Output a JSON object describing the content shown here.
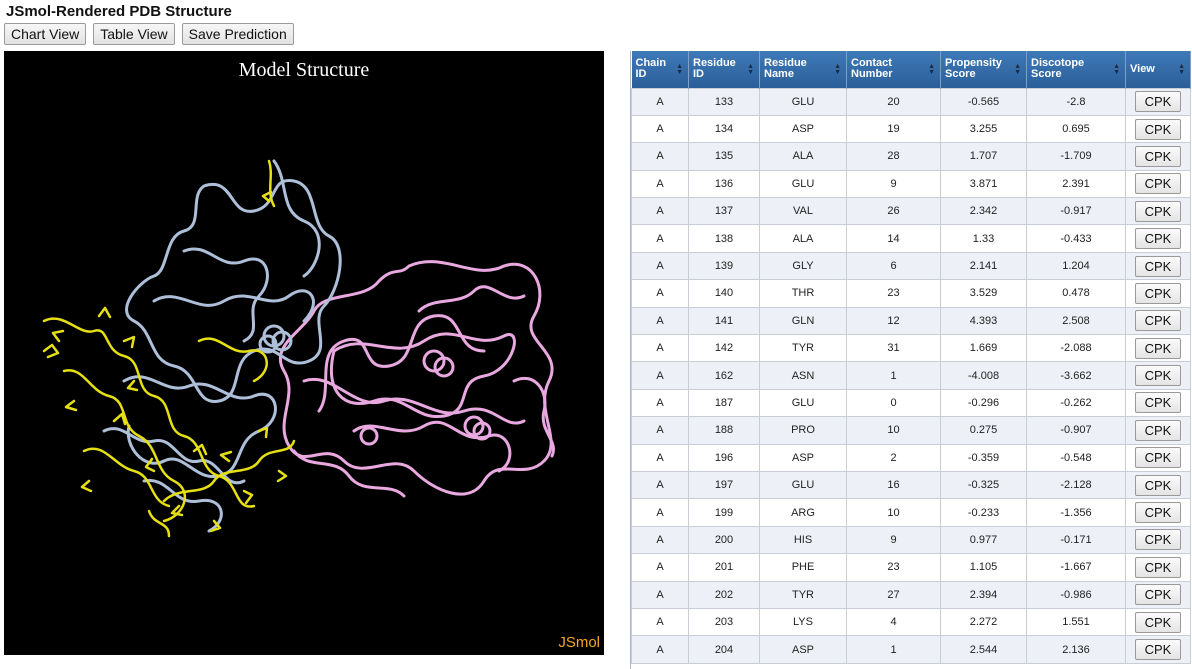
{
  "page": {
    "title": "JSmol-Rendered PDB Structure"
  },
  "toolbar": {
    "chart_view": "Chart View",
    "table_view": "Table View",
    "save_prediction": "Save Prediction"
  },
  "viewer": {
    "title": "Model Structure",
    "brand": "JSmol",
    "colors": {
      "background": "#000000",
      "chain_a": "#aebfd9",
      "chain_b": "#e9a9e0",
      "epitope": "#e6e013",
      "brand": "#f5a623"
    }
  },
  "table": {
    "headers": [
      {
        "line1": "Chain",
        "line2": "ID"
      },
      {
        "line1": "Residue",
        "line2": "ID"
      },
      {
        "line1": "Residue",
        "line2": "Name"
      },
      {
        "line1": "Contact",
        "line2": "Number"
      },
      {
        "line1": "Propensity",
        "line2": "Score"
      },
      {
        "line1": "Discotope",
        "line2": "Score"
      },
      {
        "line1": "View",
        "line2": ""
      }
    ],
    "header_color": "#3a74b3",
    "rows": [
      {
        "chain": "A",
        "residue_id": "133",
        "residue_name": "GLU",
        "contact": "20",
        "propensity": "-0.565",
        "discotope": "-2.8",
        "view": "CPK"
      },
      {
        "chain": "A",
        "residue_id": "134",
        "residue_name": "ASP",
        "contact": "19",
        "propensity": "3.255",
        "discotope": "0.695",
        "view": "CPK"
      },
      {
        "chain": "A",
        "residue_id": "135",
        "residue_name": "ALA",
        "contact": "28",
        "propensity": "1.707",
        "discotope": "-1.709",
        "view": "CPK"
      },
      {
        "chain": "A",
        "residue_id": "136",
        "residue_name": "GLU",
        "contact": "9",
        "propensity": "3.871",
        "discotope": "2.391",
        "view": "CPK"
      },
      {
        "chain": "A",
        "residue_id": "137",
        "residue_name": "VAL",
        "contact": "26",
        "propensity": "2.342",
        "discotope": "-0.917",
        "view": "CPK"
      },
      {
        "chain": "A",
        "residue_id": "138",
        "residue_name": "ALA",
        "contact": "14",
        "propensity": "1.33",
        "discotope": "-0.433",
        "view": "CPK"
      },
      {
        "chain": "A",
        "residue_id": "139",
        "residue_name": "GLY",
        "contact": "6",
        "propensity": "2.141",
        "discotope": "1.204",
        "view": "CPK"
      },
      {
        "chain": "A",
        "residue_id": "140",
        "residue_name": "THR",
        "contact": "23",
        "propensity": "3.529",
        "discotope": "0.478",
        "view": "CPK"
      },
      {
        "chain": "A",
        "residue_id": "141",
        "residue_name": "GLN",
        "contact": "12",
        "propensity": "4.393",
        "discotope": "2.508",
        "view": "CPK"
      },
      {
        "chain": "A",
        "residue_id": "142",
        "residue_name": "TYR",
        "contact": "31",
        "propensity": "1.669",
        "discotope": "-2.088",
        "view": "CPK"
      },
      {
        "chain": "A",
        "residue_id": "162",
        "residue_name": "ASN",
        "contact": "1",
        "propensity": "-4.008",
        "discotope": "-3.662",
        "view": "CPK"
      },
      {
        "chain": "A",
        "residue_id": "187",
        "residue_name": "GLU",
        "contact": "0",
        "propensity": "-0.296",
        "discotope": "-0.262",
        "view": "CPK"
      },
      {
        "chain": "A",
        "residue_id": "188",
        "residue_name": "PRO",
        "contact": "10",
        "propensity": "0.275",
        "discotope": "-0.907",
        "view": "CPK"
      },
      {
        "chain": "A",
        "residue_id": "196",
        "residue_name": "ASP",
        "contact": "2",
        "propensity": "-0.359",
        "discotope": "-0.548",
        "view": "CPK"
      },
      {
        "chain": "A",
        "residue_id": "197",
        "residue_name": "GLU",
        "contact": "16",
        "propensity": "-0.325",
        "discotope": "-2.128",
        "view": "CPK"
      },
      {
        "chain": "A",
        "residue_id": "199",
        "residue_name": "ARG",
        "contact": "10",
        "propensity": "-0.233",
        "discotope": "-1.356",
        "view": "CPK"
      },
      {
        "chain": "A",
        "residue_id": "200",
        "residue_name": "HIS",
        "contact": "9",
        "propensity": "0.977",
        "discotope": "-0.171",
        "view": "CPK"
      },
      {
        "chain": "A",
        "residue_id": "201",
        "residue_name": "PHE",
        "contact": "23",
        "propensity": "1.105",
        "discotope": "-1.667",
        "view": "CPK"
      },
      {
        "chain": "A",
        "residue_id": "202",
        "residue_name": "TYR",
        "contact": "27",
        "propensity": "2.394",
        "discotope": "-0.986",
        "view": "CPK"
      },
      {
        "chain": "A",
        "residue_id": "203",
        "residue_name": "LYS",
        "contact": "4",
        "propensity": "2.272",
        "discotope": "1.551",
        "view": "CPK"
      },
      {
        "chain": "A",
        "residue_id": "204",
        "residue_name": "ASP",
        "contact": "1",
        "propensity": "2.544",
        "discotope": "2.136",
        "view": "CPK"
      }
    ]
  }
}
